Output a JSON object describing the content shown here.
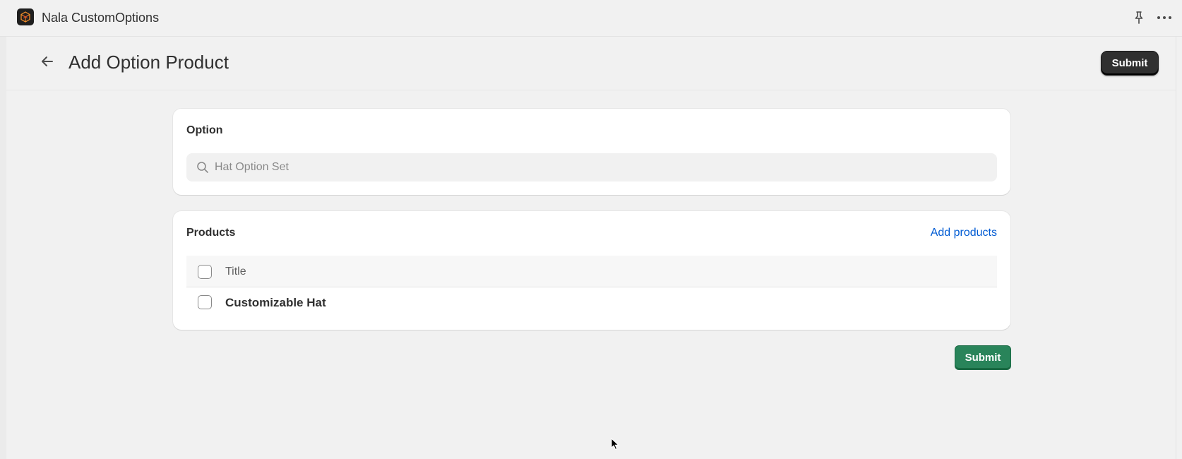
{
  "app": {
    "title": "Nala CustomOptions",
    "logo_icon": "nala-cube-logo-icon",
    "pin_icon": "pin-icon",
    "more_icon": "more-horizontal-icon"
  },
  "header": {
    "back_icon": "arrow-left-icon",
    "title": "Add Option Product",
    "submit_label": "Submit"
  },
  "option_card": {
    "heading": "Option",
    "search_icon": "search-icon",
    "search_placeholder": "Hat Option Set",
    "search_value": ""
  },
  "products_card": {
    "heading": "Products",
    "add_link": "Add products",
    "columns": [
      "Title"
    ],
    "rows": [
      {
        "title": "Customizable Hat",
        "selected": false
      }
    ]
  },
  "footer": {
    "submit_label": "Submit"
  },
  "colors": {
    "background": "#f1f1f1",
    "primary_dark": "#303030",
    "primary_green": "#29845a",
    "link_blue": "#005bd3"
  }
}
